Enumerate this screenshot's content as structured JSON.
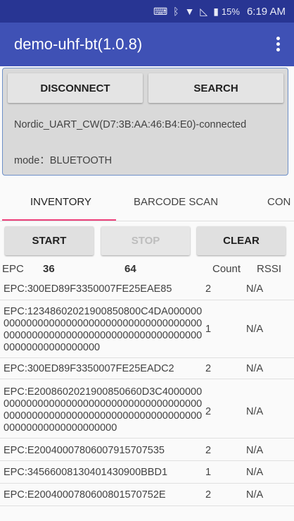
{
  "status_bar": {
    "battery": "15%",
    "time": "6:19 AM"
  },
  "app_bar": {
    "title": "demo-uhf-bt(1.0.8)"
  },
  "connection": {
    "disconnect_label": "DISCONNECT",
    "search_label": "SEARCH",
    "device_status": "Nordic_UART_CW(D7:3B:AA:46:B4:E0)-connected",
    "mode": "mode：BLUETOOTH"
  },
  "tabs": [
    {
      "label": "INVENTORY",
      "active": true
    },
    {
      "label": "BARCODE SCAN",
      "active": false
    },
    {
      "label": "CON",
      "active": false
    }
  ],
  "actions": {
    "start_label": "START",
    "stop_label": "STOP",
    "clear_label": "CLEAR"
  },
  "list_header": {
    "epc": "EPC",
    "unique_count": "36",
    "total_count": "64",
    "count": "Count",
    "rssi": "RSSI"
  },
  "rows": [
    {
      "epc": "EPC:300ED89F3350007FE25EAE85",
      "count": "2",
      "rssi": "N/A"
    },
    {
      "epc": "EPC:1234860202190085080 0C4DA000000000000000000000000000000000000000000000000000000000000000000000000000000000000000000000",
      "count": "1",
      "rssi": "N/A"
    },
    {
      "epc": "EPC:300ED89F3350007FE25EADC2",
      "count": "2",
      "rssi": "N/A"
    },
    {
      "epc": "EPC:E2008602021900850660D3C4000000000000000000000000000000000000000000000000000000000000000000000000000000000000000000000000",
      "count": "2",
      "rssi": "N/A"
    },
    {
      "epc": "EPC:E2004000780600 7915707535",
      "count": "2",
      "rssi": "N/A"
    },
    {
      "epc": "EPC:3456600813040143090 0BBD1",
      "count": "1",
      "rssi": "N/A"
    },
    {
      "epc": "EPC:E200400078060080157 0752E",
      "count": "2",
      "rssi": "N/A"
    }
  ]
}
